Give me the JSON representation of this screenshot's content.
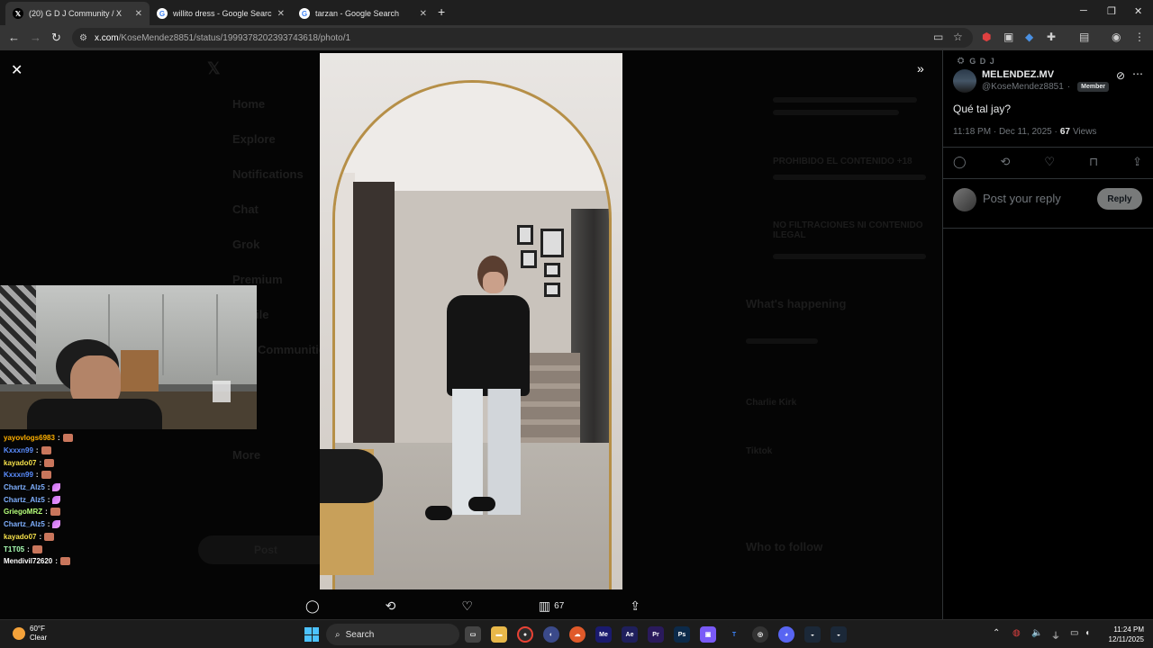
{
  "browser": {
    "tabs": [
      {
        "favicon": "X",
        "title": "(20) G D J Community / X",
        "active": true
      },
      {
        "favicon": "G",
        "title": "willito dress - Google Search",
        "active": false
      },
      {
        "favicon": "G",
        "title": "tarzan - Google Search",
        "active": false
      }
    ],
    "url_host": "x.com",
    "url_path": "/KoseMendez8851/status/1999378202393743618/photo/1"
  },
  "background_nav": [
    "Home",
    "Explore",
    "Notifications",
    "Chat",
    "Grok",
    "Premium",
    "Profile",
    "Communities",
    "More"
  ],
  "background_post_button": "Post",
  "background_right": {
    "rules": [
      "PROHIBIDO EL CONTENIDO +18",
      "NO FILTRACIONES NI CONTENIDO ILEGAL"
    ],
    "whats_happening": "What's happening",
    "trends": [
      "Charlie Kirk",
      "Tiktok"
    ],
    "who_to_follow": "Who to follow"
  },
  "photo_actions": {
    "views": "67"
  },
  "chat": [
    {
      "user": "yayovlogs6983",
      "color": "#ffb000",
      "emote": "emote"
    },
    {
      "user": "Kxxxn99",
      "color": "#5a8dff",
      "emote": "emote"
    },
    {
      "user": "kayado07",
      "color": "#f5e04a",
      "emote": "emote"
    },
    {
      "user": "Kxxxn99",
      "color": "#5a8dff",
      "emote": "emote"
    },
    {
      "user": "Chartz_Alz5",
      "color": "#7fb0ff",
      "emote": "feather"
    },
    {
      "user": "Chartz_Alz5",
      "color": "#7fb0ff",
      "emote": "feather"
    },
    {
      "user": "GriegoMRZ",
      "color": "#b6ff7a",
      "emote": "emote"
    },
    {
      "user": "Chartz_Alz5",
      "color": "#7fb0ff",
      "emote": "feather"
    },
    {
      "user": "kayado07",
      "color": "#f5e04a",
      "emote": "emote"
    },
    {
      "user": "T1T05",
      "color": "#a9ffb4",
      "emote": "emote"
    },
    {
      "user": "Mendivil72620",
      "color": "#ffffff",
      "emote": "emote"
    }
  ],
  "tweet": {
    "community": "G D J",
    "display_name": "MELENDEZ.MV",
    "handle": "@KoseMendez8851",
    "badge": "Member",
    "text": "Qué tal jay?",
    "time": "11:18 PM · Dec 11, 2025 ·",
    "views_count": "67",
    "views_label": "Views",
    "reply_placeholder": "Post your reply",
    "reply_button": "Reply"
  },
  "taskbar": {
    "temp": "60°F",
    "condition": "Clear",
    "search": "Search",
    "time": "11:24 PM",
    "date": "12/11/2025"
  }
}
